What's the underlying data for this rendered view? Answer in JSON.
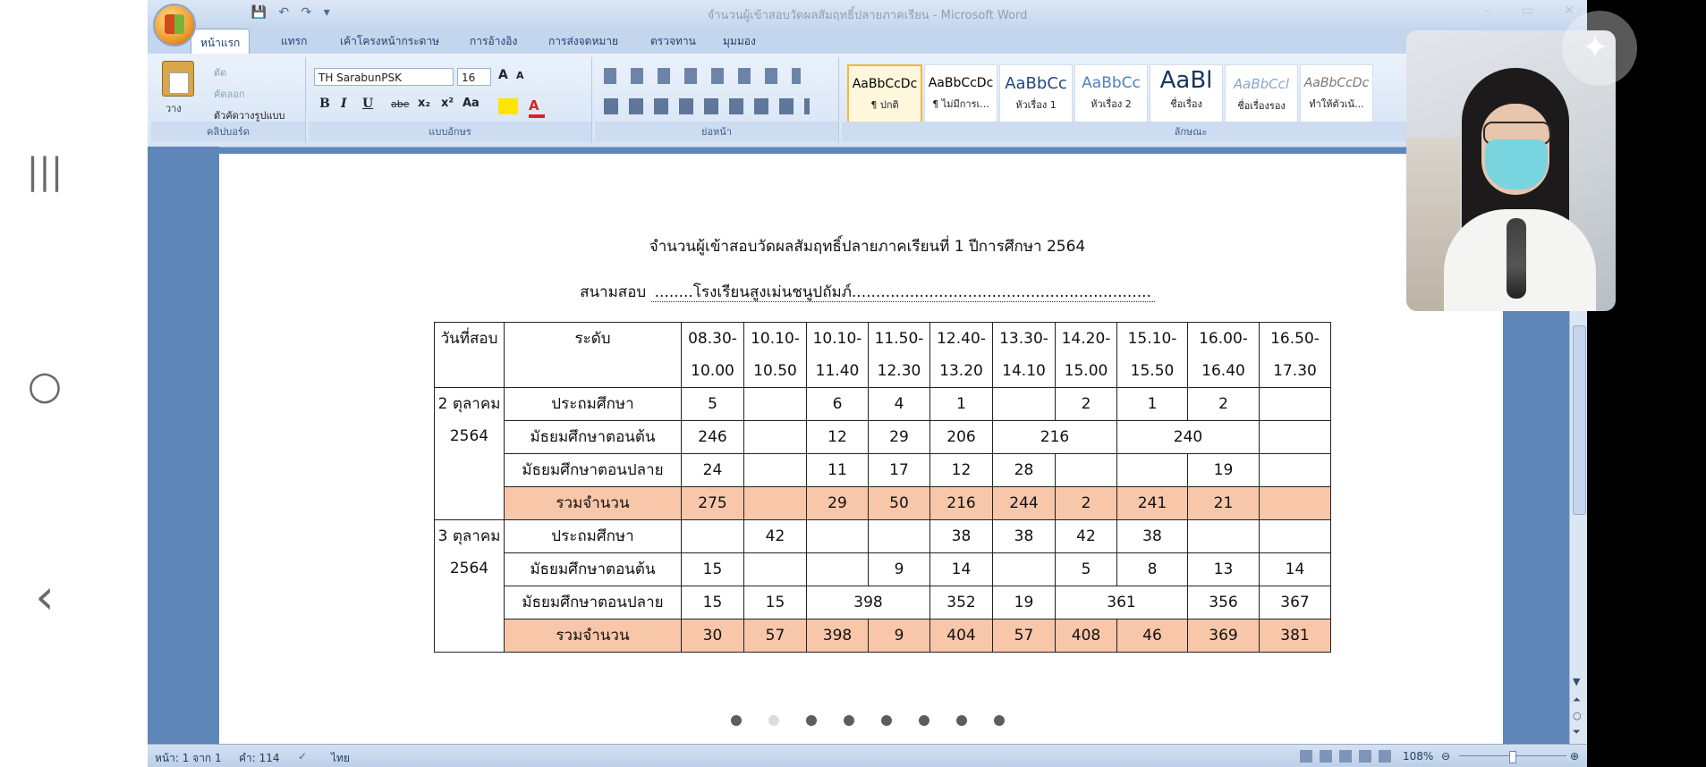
{
  "window": {
    "title": "จำนวนผู้เข้าสอบวัดผลสัมฤทธิ์ปลายภาคเรียน - Microsoft Word"
  },
  "phone_nav": {
    "recent_icon": "|||",
    "home_icon": "○",
    "back_icon": "‹"
  },
  "qat": {
    "save_icon": "💾",
    "undo_icon": "↶",
    "redo_icon": "↷",
    "more_icon": "▾"
  },
  "window_controls": {
    "minimize": "–",
    "restore": "▭",
    "close": "✕"
  },
  "tabs": [
    {
      "label": "หน้าแรก"
    },
    {
      "label": "แทรก"
    },
    {
      "label": "เค้าโครงหน้ากระดาษ"
    },
    {
      "label": "การอ้างอิง"
    },
    {
      "label": "การส่งจดหมาย"
    },
    {
      "label": "ตรวจทาน"
    },
    {
      "label": "มุมมอง"
    }
  ],
  "ribbon": {
    "clipboard": {
      "paste": "วาง",
      "cut": "ตัด",
      "copy": "คัดลอก",
      "format_painter": "ตัวคัดวางรูปแบบ",
      "label": "คลิปบอร์ด"
    },
    "font": {
      "name": "TH SarabunPSK",
      "size": "16",
      "label": "แบบอักษร",
      "bold": "B",
      "italic": "I",
      "underline": "U",
      "strike": "abe",
      "sub": "x₂",
      "sup": "x²",
      "case": "Aa",
      "grow": "A",
      "shrink": "A"
    },
    "paragraph": {
      "label": "ย่อหน้า"
    },
    "styles": {
      "label": "ลักษณะ",
      "items": [
        {
          "preview": "AaBbCcDc",
          "name": "¶ ปกติ"
        },
        {
          "preview": "AaBbCcDc",
          "name": "¶ ไม่มีการเ..."
        },
        {
          "preview": "AaBbCc",
          "name": "หัวเรื่อง 1"
        },
        {
          "preview": "AaBbCc",
          "name": "หัวเรื่อง 2"
        },
        {
          "preview": "AaBl",
          "name": "ชื่อเรื่อง"
        },
        {
          "preview": "AaBbCcl",
          "name": "ชื่อเรื่องรอง"
        },
        {
          "preview": "AaBbCcDc",
          "name": "ทำให้ตัวเน้..."
        }
      ]
    }
  },
  "document": {
    "title": "จำนวนผู้เข้าสอบวัดผลสัมฤทธิ์ปลายภาคเรียนที่ 1 ปีการศึกษา 2564",
    "venue_label": "สนามสอบ",
    "venue_value": "........โรงเรียนสูงเม่นชนูปถัมภ์..............................................................",
    "table": {
      "header_date": "วันที่สอบ",
      "header_level": "ระดับ",
      "time_slots": [
        {
          "start": "08.30-",
          "end": "10.00"
        },
        {
          "start": "10.10-",
          "end": "10.50"
        },
        {
          "start": "10.10-",
          "end": "11.40"
        },
        {
          "start": "11.50-",
          "end": "12.30"
        },
        {
          "start": "12.40-",
          "end": "13.20"
        },
        {
          "start": "13.30-",
          "end": "14.10"
        },
        {
          "start": "14.20-",
          "end": "15.00"
        },
        {
          "start": "15.10-",
          "end": "15.50"
        },
        {
          "start": "16.00-",
          "end": "16.40"
        },
        {
          "start": "16.50-",
          "end": "17.30"
        }
      ],
      "days": [
        {
          "date_line1": "2 ตุลาคม",
          "date_line2": "2564",
          "rows": [
            {
              "level": "ประถมศึกษา",
              "cells": [
                {
                  "v": "5",
                  "span": 1
                },
                {
                  "v": "",
                  "span": 1
                },
                {
                  "v": "6",
                  "span": 1
                },
                {
                  "v": "4",
                  "span": 1
                },
                {
                  "v": "1",
                  "span": 1
                },
                {
                  "v": "",
                  "span": 1
                },
                {
                  "v": "2",
                  "span": 1
                },
                {
                  "v": "1",
                  "span": 1
                },
                {
                  "v": "2",
                  "span": 1
                },
                {
                  "v": "",
                  "span": 1
                }
              ]
            },
            {
              "level": "มัธยมศึกษาตอนต้น",
              "cells": [
                {
                  "v": "246",
                  "span": 1
                },
                {
                  "v": "",
                  "span": 1
                },
                {
                  "v": "12",
                  "span": 1
                },
                {
                  "v": "29",
                  "span": 1
                },
                {
                  "v": "206",
                  "span": 1
                },
                {
                  "v": "216",
                  "span": 2
                },
                {
                  "v": "240",
                  "span": 2
                },
                {
                  "v": "",
                  "span": 1
                }
              ]
            },
            {
              "level": "มัธยมศึกษาตอนปลาย",
              "cells": [
                {
                  "v": "24",
                  "span": 1
                },
                {
                  "v": "",
                  "span": 1
                },
                {
                  "v": "11",
                  "span": 1
                },
                {
                  "v": "17",
                  "span": 1
                },
                {
                  "v": "12",
                  "span": 1
                },
                {
                  "v": "28",
                  "span": 1
                },
                {
                  "v": "",
                  "span": 1
                },
                {
                  "v": "",
                  "span": 1
                },
                {
                  "v": "19",
                  "span": 1
                },
                {
                  "v": "",
                  "span": 1
                }
              ]
            }
          ],
          "total": {
            "label": "รวมจำนวน",
            "cells": [
              "275",
              "",
              "29",
              "50",
              "216",
              "244",
              "2",
              "241",
              "21",
              ""
            ]
          }
        },
        {
          "date_line1": "3 ตุลาคม",
          "date_line2": "2564",
          "rows": [
            {
              "level": "ประถมศึกษา",
              "cells": [
                {
                  "v": "",
                  "span": 1
                },
                {
                  "v": "42",
                  "span": 1
                },
                {
                  "v": "",
                  "span": 1
                },
                {
                  "v": "",
                  "span": 1
                },
                {
                  "v": "38",
                  "span": 1
                },
                {
                  "v": "38",
                  "span": 1
                },
                {
                  "v": "42",
                  "span": 1
                },
                {
                  "v": "38",
                  "span": 1
                },
                {
                  "v": "",
                  "span": 1
                },
                {
                  "v": "",
                  "span": 1
                }
              ]
            },
            {
              "level": "มัธยมศึกษาตอนต้น",
              "cells": [
                {
                  "v": "15",
                  "span": 1
                },
                {
                  "v": "",
                  "span": 1
                },
                {
                  "v": "",
                  "span": 1
                },
                {
                  "v": "9",
                  "span": 1
                },
                {
                  "v": "14",
                  "span": 1
                },
                {
                  "v": "",
                  "span": 1
                },
                {
                  "v": "5",
                  "span": 1
                },
                {
                  "v": "8",
                  "span": 1
                },
                {
                  "v": "13",
                  "span": 1
                },
                {
                  "v": "14",
                  "span": 1
                }
              ]
            },
            {
              "level": "มัธยมศึกษาตอนปลาย",
              "cells": [
                {
                  "v": "15",
                  "span": 1
                },
                {
                  "v": "15",
                  "span": 1
                },
                {
                  "v": "398",
                  "span": 2
                },
                {
                  "v": "352",
                  "span": 1
                },
                {
                  "v": "19",
                  "span": 1
                },
                {
                  "v": "361",
                  "span": 2
                },
                {
                  "v": "356",
                  "span": 1
                },
                {
                  "v": "367",
                  "span": 1
                }
              ]
            }
          ],
          "total": {
            "label": "รวมจำนวน",
            "cells": [
              "30",
              "57",
              "398",
              "9",
              "404",
              "57",
              "408",
              "46",
              "369",
              "381"
            ]
          }
        }
      ]
    }
  },
  "pager_dots": [
    true,
    false,
    true,
    true,
    true,
    true,
    true,
    true
  ],
  "status": {
    "page": "หน้า: 1 จาก 1",
    "words": "คำ: 114",
    "language": "ไทย",
    "zoom": "108%"
  }
}
